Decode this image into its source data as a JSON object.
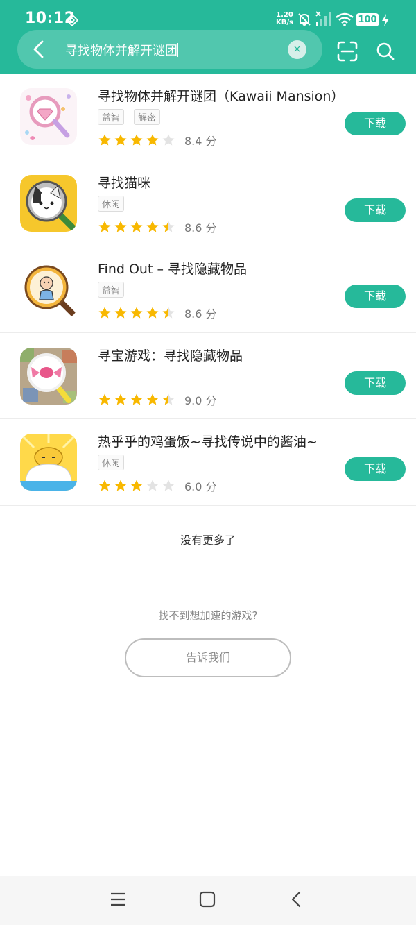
{
  "status_bar": {
    "time": "10:12",
    "net_speed_value": "1.20",
    "net_speed_unit": "KB/s",
    "battery": "100"
  },
  "search": {
    "query": "寻找物体并解开谜团",
    "clear_icon": "×"
  },
  "results": [
    {
      "title": "寻找物体并解开谜团（Kawaii Mansion）",
      "tags": [
        "益智",
        "解密"
      ],
      "rating": 4,
      "score": "8.4 分",
      "button": "下载",
      "icon": "magnifier-diamond-icon"
    },
    {
      "title": "寻找猫咪",
      "tags": [
        "休闲"
      ],
      "rating": 4.5,
      "score": "8.6 分",
      "button": "下载",
      "icon": "cat-magnifier-icon"
    },
    {
      "title": "Find Out – 寻找隐藏物品",
      "tags": [
        "益智"
      ],
      "rating": 4.5,
      "score": "8.6 分",
      "button": "下载",
      "icon": "baby-magnifier-icon"
    },
    {
      "title": "寻宝游戏：寻找隐藏物品",
      "tags": [],
      "rating": 4.5,
      "score": "9.0 分",
      "button": "下载",
      "icon": "candy-magnifier-icon"
    },
    {
      "title": "热乎乎的鸡蛋饭~寻找传说中的酱油~",
      "tags": [
        "休闲"
      ],
      "rating": 3,
      "score": "6.0 分",
      "button": "下载",
      "icon": "egg-rice-icon"
    }
  ],
  "footer": {
    "no_more": "没有更多了",
    "not_found": "找不到想加速的游戏?",
    "tell_us": "告诉我们"
  },
  "colors": {
    "accent": "#26b99a",
    "star_on": "#f8b800",
    "star_off": "#e3e3e3"
  }
}
